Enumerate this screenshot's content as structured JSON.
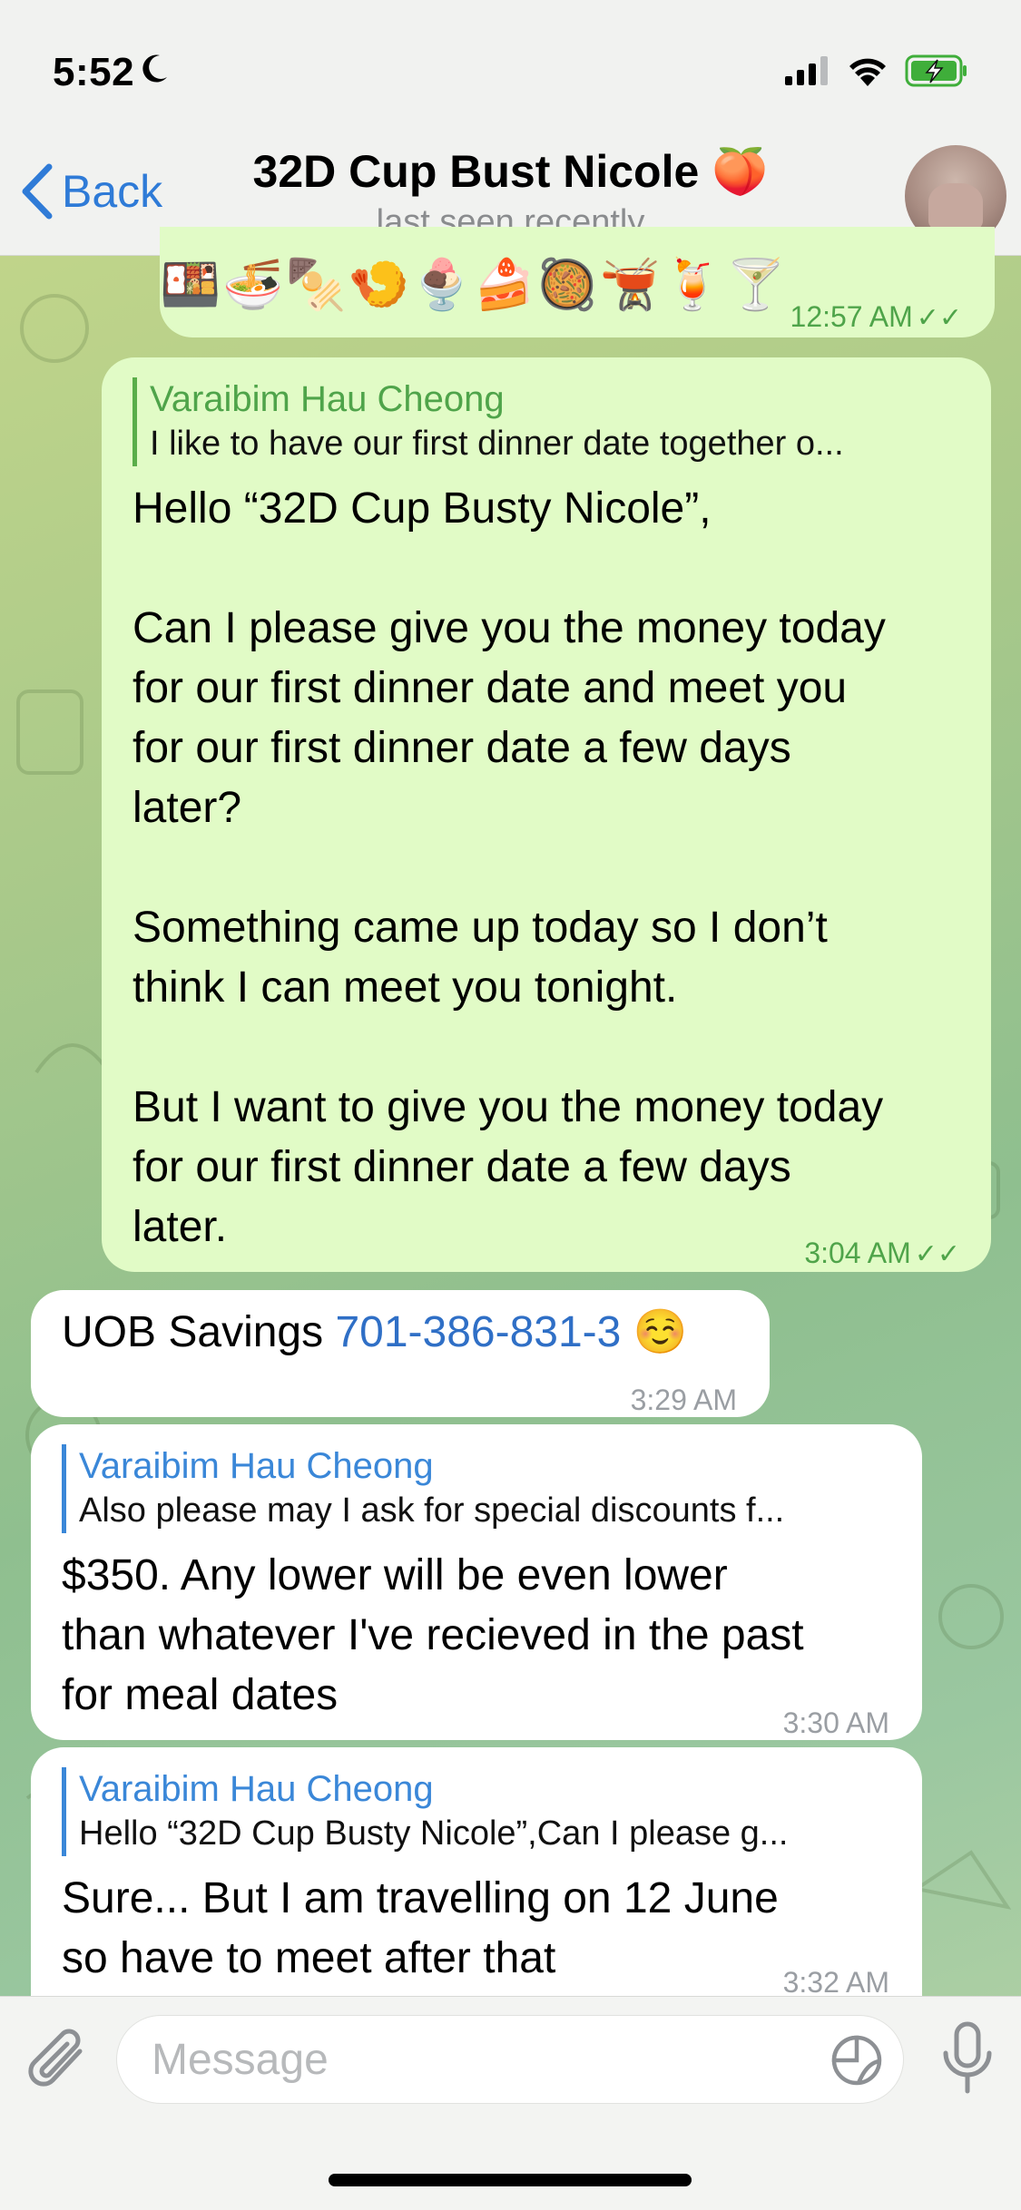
{
  "status_bar": {
    "time": "5:52"
  },
  "header": {
    "back_label": "Back",
    "title": "32D Cup Bust Nicole 🍑",
    "subtitle": "last seen recently"
  },
  "messages": [
    {
      "type": "outgoing",
      "text": "🍱🍜🍢🍤🍨🍰🥘🫕🍹🍸",
      "time": "12:57 AM"
    },
    {
      "type": "outgoing",
      "reply_name": "Varaibim Hau Cheong",
      "reply_text": "I like to have our first dinner date together o...",
      "text": "Hello “32D Cup Busty Nicole”,\n\nCan I please give you the money today\nfor our first dinner date and meet you\nfor our first dinner date a few days\nlater?\n\nSomething came up today so I don’t\nthink I can meet you tonight.\n\nBut I want to give you the money today\nfor our first dinner date a few days\nlater.",
      "time": "3:04 AM"
    },
    {
      "type": "incoming",
      "text_prefix": "UOB Savings ",
      "link": "701-386-831-3",
      "text_suffix": " ☺️",
      "time": "3:29 AM"
    },
    {
      "type": "incoming",
      "reply_name": "Varaibim Hau Cheong",
      "reply_text": "Also please may I ask for special discounts f...",
      "text": "$350. Any lower will be even lower\nthan whatever I've recieved in the past\nfor meal dates",
      "time": "3:30 AM"
    },
    {
      "type": "incoming",
      "reply_name": "Varaibim Hau Cheong",
      "reply_text": "Hello “32D Cup Busty Nicole”,Can I please g...",
      "text": "Sure... But I am travelling on 12 June\nso have to meet after that",
      "time": "3:32 AM"
    }
  ],
  "input": {
    "placeholder": "Message"
  },
  "icons": {
    "back": "chevron-left-icon",
    "attach": "paperclip-icon",
    "sticker": "sticker-icon",
    "mic": "microphone-icon",
    "read": "double-check-icon"
  },
  "colors": {
    "accent": "#2f7bd7",
    "outgoing_bubble": "#e1fbc6",
    "incoming_bubble": "#ffffff",
    "outgoing_meta": "#4fa44a",
    "reply_name_in": "#3a87d8"
  }
}
